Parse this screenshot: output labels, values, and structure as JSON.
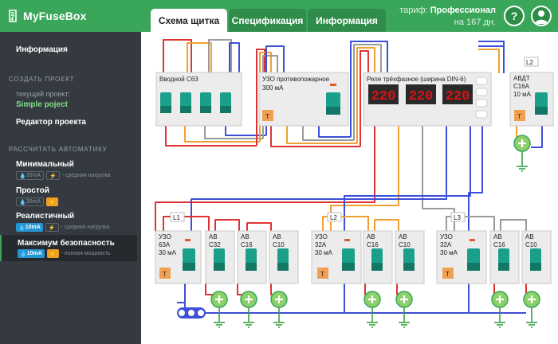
{
  "app": {
    "name": "MyFuseBox",
    "tabs": [
      {
        "label": "Схема щитка",
        "active": true
      },
      {
        "label": "Спецификация",
        "active": false
      },
      {
        "label": "Информация",
        "active": false
      }
    ],
    "tariff": {
      "label": "тариф:",
      "value": "Профессионал",
      "days": "на 167 дн."
    },
    "help_label": "?"
  },
  "sidebar": {
    "info_link": "Информация",
    "create_section": "СОЗДАТЬ ПРОЕКТ",
    "current_project_label": "текущий проект:",
    "current_project_name": "Simple poject",
    "editor_link": "Редактор проекта",
    "calc_section": "РАССЧИТАТЬ АВТОМАТИКУ",
    "calc_options": [
      {
        "title": "Минимальный",
        "rcd": "30mA",
        "bolt": "⚡",
        "desc": "- средняя нагрузка",
        "active": false
      },
      {
        "title": "Простой",
        "rcd": "30mA",
        "bolt": "⚡",
        "desc": "",
        "active": false
      },
      {
        "title": "Реалистичный",
        "rcd": "10mA",
        "bolt": "⚡",
        "desc": "- средняя нагрузка",
        "active": false
      },
      {
        "title": "Максимум безопасность",
        "rcd": "10mA",
        "bolt": "⚡",
        "desc": "- полная мощность",
        "active": true
      }
    ]
  },
  "scheme": {
    "colors": {
      "phase_red": "#e03232",
      "phase_orange": "#f0a030",
      "phase_gray": "#9a9a9a",
      "phase_blue": "#3c4fd8",
      "neutral_blue": "#2c7be5",
      "pe_green": "#2e9a3c",
      "rcd_test": "#f0a050",
      "digit_red": "#e01010"
    },
    "top_row": {
      "main_switch": {
        "title": "Вводной С63"
      },
      "fire_rcd": {
        "title": "УЗО противопожарное",
        "rating": "300 мА",
        "test": "T"
      },
      "relay": {
        "title": "Реле трёхфазное (ширина DIN-6)",
        "displays": [
          "220",
          "220",
          "220"
        ]
      },
      "avdt": {
        "phase": "L2",
        "title": "АВДТ",
        "rating": "С16А",
        "leak": "10 мА",
        "test": "T"
      }
    },
    "groups": [
      {
        "phase": "L1",
        "rcd": {
          "title": "УЗО",
          "rating": "63А",
          "leak": "30 мА",
          "test": "T"
        },
        "breakers": [
          {
            "title": "АВ",
            "rating": "С32"
          },
          {
            "title": "АВ",
            "rating": "С16"
          },
          {
            "title": "АВ",
            "rating": "С10"
          }
        ]
      },
      {
        "phase": "L2",
        "rcd": {
          "title": "УЗО",
          "rating": "32А",
          "leak": "30 мА",
          "test": "T"
        },
        "breakers": [
          {
            "title": "АВ",
            "rating": "С16"
          },
          {
            "title": "АВ",
            "rating": "С10"
          }
        ]
      },
      {
        "phase": "L3",
        "rcd": {
          "title": "УЗО",
          "rating": "32А",
          "leak": "30 мА",
          "test": "T"
        },
        "breakers": [
          {
            "title": "АВ",
            "rating": "С16"
          },
          {
            "title": "АВ",
            "rating": "С10"
          }
        ]
      }
    ],
    "icons": {
      "load": "plus-circle-icon",
      "ground": "ground-icon",
      "neutral_bus": "neutral-bus-icon"
    }
  }
}
